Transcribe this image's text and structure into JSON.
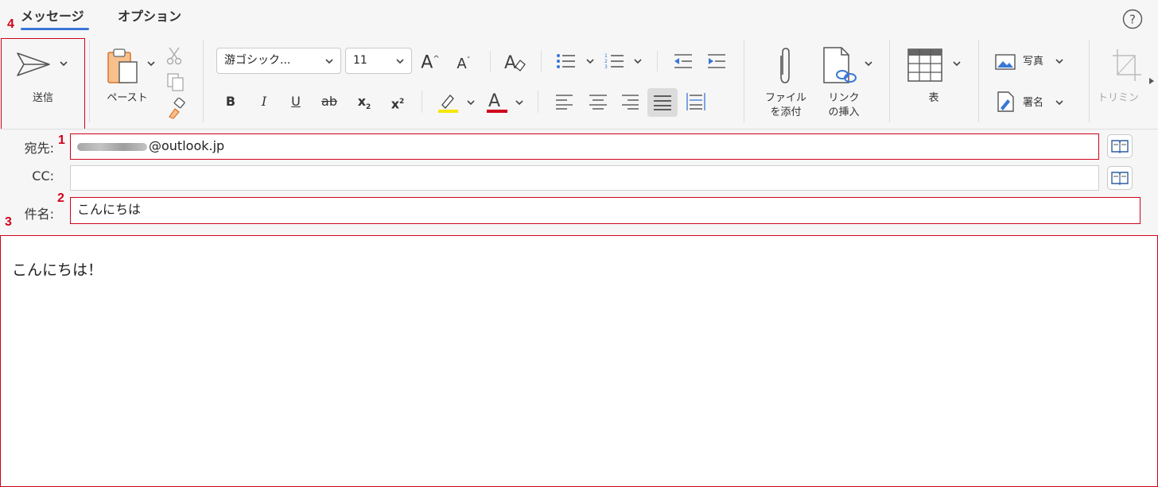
{
  "tabs": [
    "メッセージ",
    "オプション"
  ],
  "ribbon": {
    "send": "送信",
    "paste": "ペースト",
    "font_name": "游ゴシック...",
    "font_size": "11",
    "bold": "B",
    "italic": "I",
    "underline": "U",
    "strike": "ab",
    "subscript": "x",
    "subscript_mark": "2",
    "superscript": "x",
    "superscript_mark": "2",
    "attach_line1": "ファイル",
    "attach_line2": "を添付",
    "link_line1": "リンク",
    "link_line2": "の挿入",
    "table": "表",
    "photo": "写真",
    "signature": "署名",
    "trim": "トリミン",
    "grow_font": "A",
    "shrink_font": "A"
  },
  "fields": {
    "to_label": "宛先:",
    "to_value": "@outlook.jp",
    "cc_label": "CC:",
    "cc_value": "",
    "subject_label": "件名:",
    "subject_value": "こんにちは"
  },
  "body_text": "こんにちは！",
  "annotations": [
    "1",
    "2",
    "3",
    "4"
  ],
  "colors": {
    "accent": "#3a77d6",
    "annotation_red": "#d0021b",
    "highlight_yellow": "#f5e600",
    "font_color_red": "#d0021b"
  }
}
